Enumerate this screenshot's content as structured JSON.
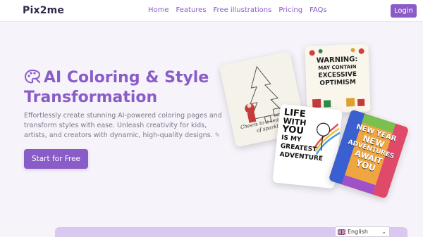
{
  "brand": {
    "logo_text": "Pix2me"
  },
  "nav": {
    "links": [
      "Home",
      "Features",
      "Free illustrations",
      "Pricing",
      "FAQs"
    ],
    "login_label": "Login"
  },
  "hero": {
    "title": "AI Coloring & Style Transformation",
    "description": "Effortlessly create stunning AI-powered coloring pages and transform styles with ease. Unleash creativity for kids, artists, and creators with dynamic, high-quality designs.",
    "cta_label": "Start for Free"
  },
  "cards": {
    "card1_text": "Cheers to a season full of sparkle!",
    "card2_text": [
      "WARNING:",
      "MAY CONTAIN",
      "EXCESSIVE",
      "OPTIMISM"
    ],
    "card3_text": [
      "LIFE",
      "WITH",
      "YOU",
      "IS MY",
      "GREATEST",
      "ADVENTURE"
    ],
    "card4_text": [
      "NEW YEAR",
      "NEW",
      "ADVENTURES",
      "AWAIT",
      "YOU"
    ]
  },
  "language": {
    "selected": "English"
  },
  "colors": {
    "accent": "#8a5cc7",
    "background": "#f6f4fa"
  }
}
